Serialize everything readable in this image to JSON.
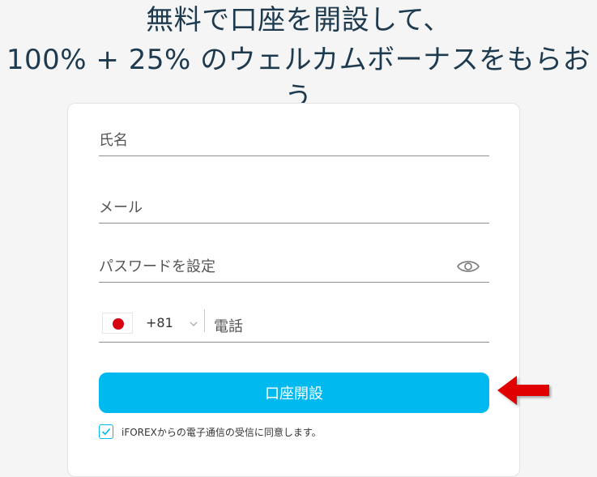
{
  "headline": {
    "line1": "無料で口座を開設して、",
    "line2": "100% + 25% のウェルカムボーナスをもらおう"
  },
  "form": {
    "name_placeholder": "氏名",
    "email_placeholder": "メール",
    "password_placeholder": "パスワードを設定",
    "country_code": "+81",
    "phone_placeholder": "電話",
    "submit_label": "口座開設",
    "consent_text": "iFOREXからの電子通信の受信に同意します。",
    "consent_checked": true
  },
  "icons": {
    "password_toggle": "eye-icon",
    "country_flag": "japan-flag-icon",
    "country_dropdown": "chevron-down-icon",
    "checkbox_mark": "checkmark-icon",
    "annotation": "red-arrow-left-icon"
  },
  "colors": {
    "accent": "#00b9ef",
    "headline": "#1e3a4f",
    "annotation_arrow": "#e00000"
  }
}
